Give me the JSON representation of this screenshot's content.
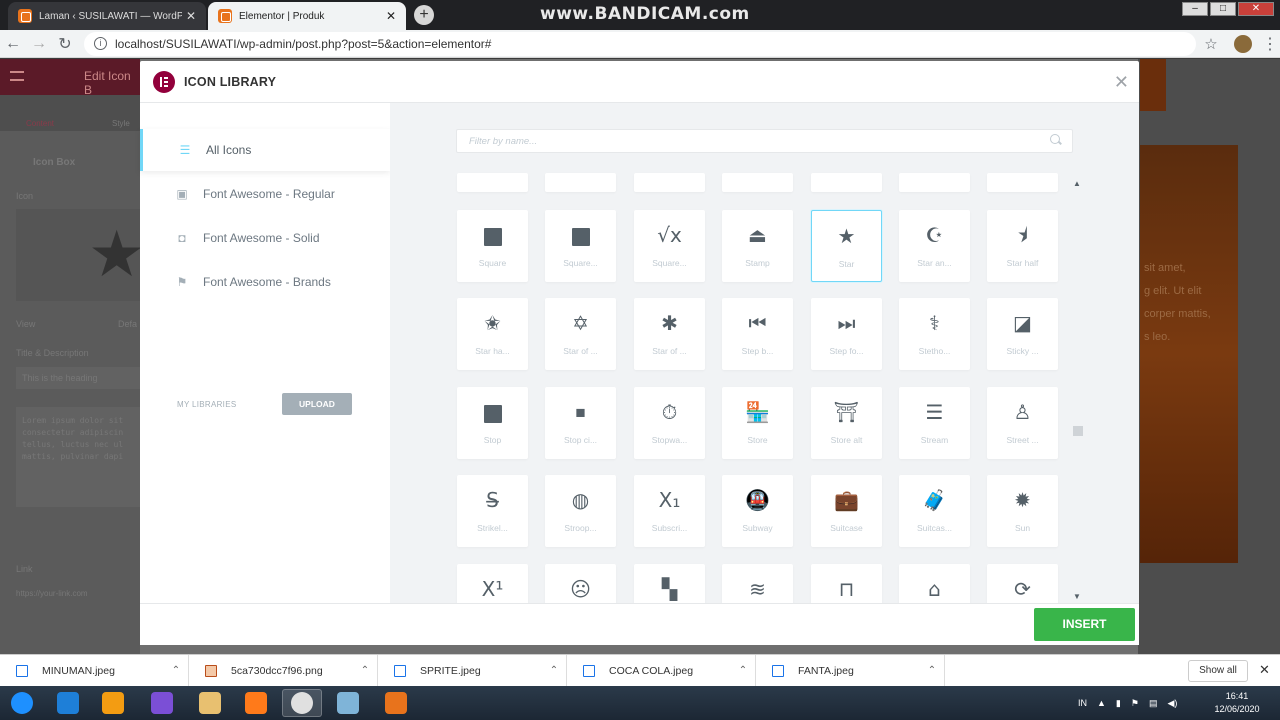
{
  "browser": {
    "tabs": [
      {
        "title": "Laman ‹ SUSILAWATI — WordPr…",
        "close": "✕"
      },
      {
        "title": "Elementor | Produk",
        "close": "✕"
      }
    ],
    "new_tab": "+",
    "watermark": "www.BANDICAM.com",
    "url": "localhost/SUSILAWATI/wp-admin/post.php?post=5&action=elementor#"
  },
  "background": {
    "panel_title": "Edit Icon B",
    "content_tab": "Content",
    "style_tab": "Style",
    "section_title": "Icon Box",
    "icon_label": "Icon",
    "view_label": "View",
    "view_value": "Defa",
    "title_desc_label": "Title & Description",
    "title_value": "This is the heading",
    "desc_value": "Lorem ipsum dolor sit consectetur adipiscin tellus, luctus nec ul mattis, pulvinar dapi",
    "link_label": "Link",
    "link_placeholder": "https://your-link.com",
    "preview_text_1": "sit amet,",
    "preview_text_2": "g elit. Ut elit",
    "preview_text_3": "corper mattis,",
    "preview_text_4": "s leo."
  },
  "modal": {
    "title": "ICON LIBRARY",
    "close": "✕",
    "sidebar": [
      {
        "label": "All Icons",
        "icon": "filter-icon"
      },
      {
        "label": "Font Awesome - Regular",
        "icon": "font-awesome-regular-icon"
      },
      {
        "label": "Font Awesome - Solid",
        "icon": "font-awesome-solid-icon"
      },
      {
        "label": "Font Awesome - Brands",
        "icon": "font-awesome-brands-icon"
      }
    ],
    "my_libraries": "MY LIBRARIES",
    "upload": "UPLOAD",
    "search_placeholder": "Filter by name...",
    "insert": "INSERT",
    "icons": [
      {
        "glyph": "■",
        "label": "Square",
        "name": "square-icon"
      },
      {
        "glyph": "■",
        "label": "Square...",
        "name": "square-full-icon"
      },
      {
        "glyph": "√x",
        "label": "Square...",
        "name": "square-root-icon"
      },
      {
        "glyph": "⏏",
        "label": "Stamp",
        "name": "stamp-icon"
      },
      {
        "glyph": "★",
        "label": "Star",
        "name": "star-icon"
      },
      {
        "glyph": "☪",
        "label": "Star an...",
        "name": "star-and-crescent-icon"
      },
      {
        "glyph": "⯨",
        "label": "Star half",
        "name": "star-half-icon"
      },
      {
        "glyph": "✬",
        "label": "Star ha...",
        "name": "star-half-alt-icon"
      },
      {
        "glyph": "✡",
        "label": "Star of ...",
        "name": "star-of-david-icon"
      },
      {
        "glyph": "✱",
        "label": "Star of ...",
        "name": "star-of-life-icon"
      },
      {
        "glyph": "⏮",
        "label": "Step b...",
        "name": "step-backward-icon"
      },
      {
        "glyph": "⏭",
        "label": "Step fo...",
        "name": "step-forward-icon"
      },
      {
        "glyph": "⚕",
        "label": "Stetho...",
        "name": "stethoscope-icon"
      },
      {
        "glyph": "◪",
        "label": "Sticky ...",
        "name": "sticky-note-icon"
      },
      {
        "glyph": "■",
        "label": "Stop",
        "name": "stop-icon"
      },
      {
        "glyph": "⏹",
        "label": "Stop ci...",
        "name": "stop-circle-icon"
      },
      {
        "glyph": "⏱",
        "label": "Stopwa...",
        "name": "stopwatch-icon"
      },
      {
        "glyph": "🏪",
        "label": "Store",
        "name": "store-icon"
      },
      {
        "glyph": "⛩",
        "label": "Store alt",
        "name": "store-alt-icon"
      },
      {
        "glyph": "☰",
        "label": "Stream",
        "name": "stream-icon"
      },
      {
        "glyph": "♙",
        "label": "Street ...",
        "name": "street-view-icon"
      },
      {
        "glyph": "S̶",
        "label": "Strikel...",
        "name": "strikethrough-icon"
      },
      {
        "glyph": "◍",
        "label": "Stroop...",
        "name": "stroopwafel-icon"
      },
      {
        "glyph": "X₁",
        "label": "Subscri...",
        "name": "subscript-icon"
      },
      {
        "glyph": "🚇",
        "label": "Subway",
        "name": "subway-icon"
      },
      {
        "glyph": "💼",
        "label": "Suitcase",
        "name": "suitcase-icon"
      },
      {
        "glyph": "🧳",
        "label": "Suitcas...",
        "name": "suitcase-rolling-icon"
      },
      {
        "glyph": "✹",
        "label": "Sun",
        "name": "sun-icon"
      },
      {
        "glyph": "X¹",
        "label": "",
        "name": "superscript-icon"
      },
      {
        "glyph": "☹",
        "label": "",
        "name": "surprise-icon"
      },
      {
        "glyph": "▚",
        "label": "",
        "name": "swatchbook-icon"
      },
      {
        "glyph": "≋",
        "label": "",
        "name": "swimmer-icon"
      },
      {
        "glyph": "⊓",
        "label": "",
        "name": "swimming-pool-icon"
      },
      {
        "glyph": "⌂",
        "label": "",
        "name": "synagogue-icon"
      },
      {
        "glyph": "⟳",
        "label": "",
        "name": "sync-icon"
      }
    ],
    "selected_index": 4
  },
  "downloads": [
    {
      "name": "MINUMAN.jpeg",
      "type": "jpeg"
    },
    {
      "name": "5ca730dcc7f96.png",
      "type": "png"
    },
    {
      "name": "SPRITE.jpeg",
      "type": "jpeg"
    },
    {
      "name": "COCA COLA.jpeg",
      "type": "jpeg"
    },
    {
      "name": "FANTA.jpeg",
      "type": "jpeg"
    }
  ],
  "show_all": "Show all",
  "taskbar": {
    "lang": "IN",
    "time": "16:41",
    "date": "12/06/2020",
    "colors": [
      "#1e90ff",
      "#1e7fd8",
      "#f39c12",
      "#7b4fd6",
      "#e8c070",
      "#ff7a1a",
      "#e0e0e0",
      "#7fb4d8",
      "#e8731c"
    ]
  },
  "colors": {
    "accent": "#71d7f7",
    "insert": "#39b54a",
    "logo": "#92003b"
  }
}
